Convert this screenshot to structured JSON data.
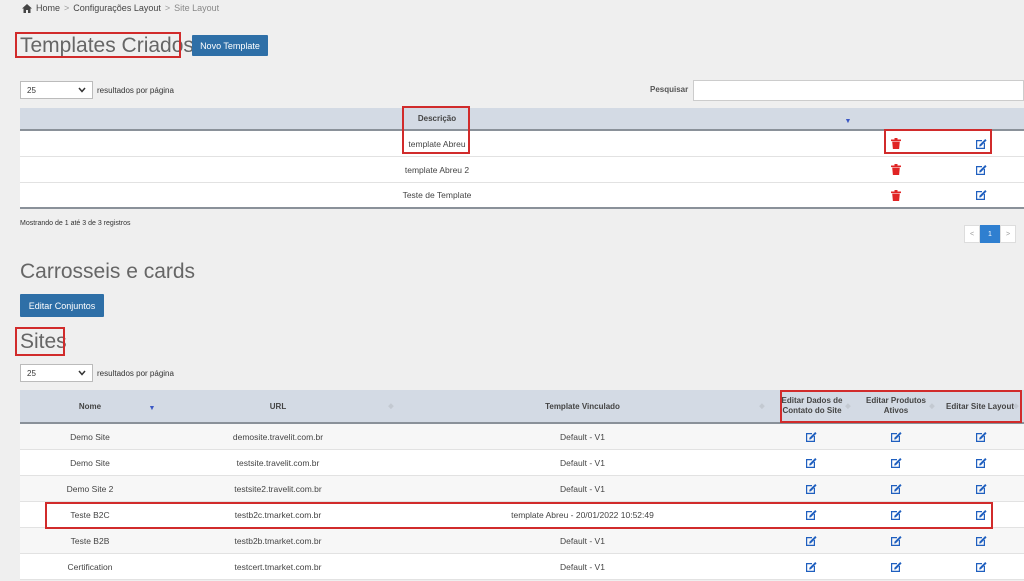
{
  "breadcrumb": {
    "home": "Home",
    "sep1": ">",
    "config": "Configurações Layout",
    "sep2": ">",
    "current": "Site Layout"
  },
  "templates": {
    "title": "Templates Criados",
    "new_button": "Novo Template",
    "page_size": "25",
    "per_page_label": "resultados por página",
    "search_label": "Pesquisar",
    "search_value": "",
    "col_desc": "Descrição",
    "rows": [
      {
        "desc": "template Abreu"
      },
      {
        "desc": "template Abreu 2"
      },
      {
        "desc": "Teste de Template"
      }
    ],
    "info": "Mostrando de 1 até 3 de 3 registros",
    "pager": {
      "prev": "<",
      "page": "1",
      "next": ">"
    }
  },
  "carousels": {
    "title": "Carrosseis e cards",
    "edit_button": "Editar Conjuntos"
  },
  "sites": {
    "title": "Sites",
    "page_size": "25",
    "per_page_label": "resultados por página",
    "columns": {
      "nome": "Nome",
      "url": "URL",
      "template": "Template Vinculado",
      "contato": "Editar Dados de Contato do Site",
      "produtos": "Editar Produtos Ativos",
      "layout": "Editar Site Layout"
    },
    "rows": [
      {
        "nome": "Demo Site",
        "url": "demosite.travelit.com.br",
        "template": "Default - V1"
      },
      {
        "nome": "Demo Site",
        "url": "testsite.travelit.com.br",
        "template": "Default - V1"
      },
      {
        "nome": "Demo Site 2",
        "url": "testsite2.travelit.com.br",
        "template": "Default - V1"
      },
      {
        "nome": "Teste B2C",
        "url": "testb2c.tmarket.com.br",
        "template": "template Abreu - 20/01/2022 10:52:49"
      },
      {
        "nome": "Teste B2B",
        "url": "testb2b.tmarket.com.br",
        "template": "Default - V1"
      },
      {
        "nome": "Certification",
        "url": "testcert.tmarket.com.br",
        "template": "Default - V1"
      }
    ]
  },
  "colors": {
    "accent": "#2e6fa7",
    "highlight": "#d12b2b",
    "delete": "#e02424",
    "edit": "#1f5fbf"
  }
}
